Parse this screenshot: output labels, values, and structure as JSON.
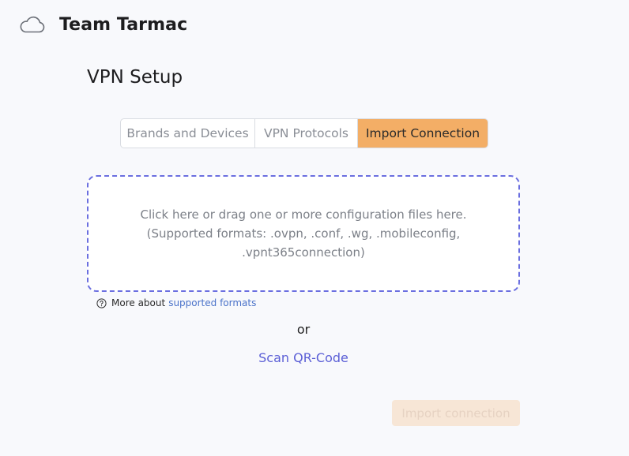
{
  "header": {
    "team_name": "Team Tarmac",
    "icon": "cloud-icon"
  },
  "page": {
    "title": "VPN Setup"
  },
  "tabs": [
    {
      "label": "Brands and Devices",
      "active": false
    },
    {
      "label": "VPN Protocols",
      "active": false
    },
    {
      "label": "Import Connection",
      "active": true
    }
  ],
  "dropzone": {
    "line1": "Click here or drag one or more configuration files here.",
    "line2": "(Supported formats: .ovpn, .conf, .wg, .mobileconfig,",
    "line3": ".vpnt365connection)"
  },
  "help": {
    "icon": "question-circle-icon",
    "prefix": "More about",
    "link_text": "supported formats"
  },
  "alternative": {
    "or_text": "or",
    "scan_label": "Scan QR-Code"
  },
  "footer": {
    "import_label": "Import connection",
    "import_disabled": true
  },
  "colors": {
    "accent": "#f3ae66",
    "link": "#5b5fd6",
    "dropzone_border": "#6b6fe0"
  }
}
